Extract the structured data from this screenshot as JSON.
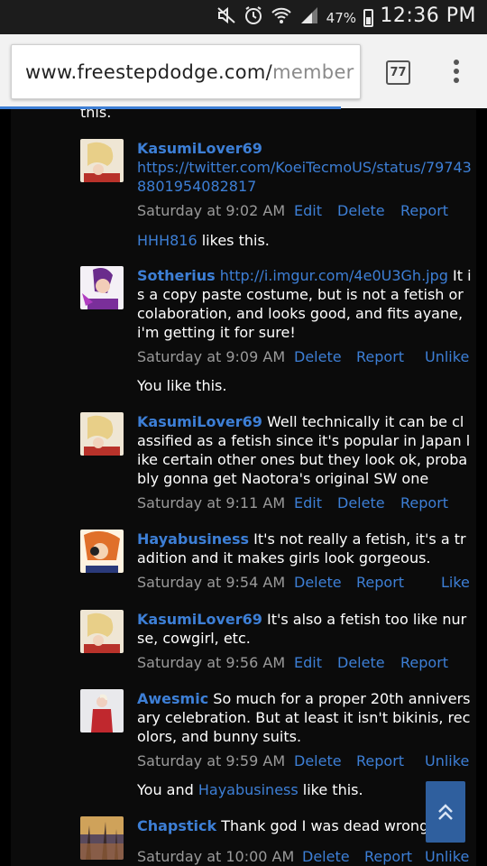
{
  "status_bar": {
    "battery": "47%",
    "time": "12:36 PM"
  },
  "url_bar": {
    "domain": "www.freestepdodge.com/",
    "path": "member",
    "tab_count": "77"
  },
  "thread": {
    "top_fragment": "this.",
    "comments": [
      {
        "user": "KasumiLover69",
        "link": "https://twitter.com/KoeiTecmoUS/status/797438801954082817",
        "text": "",
        "time": "Saturday at 9:02 AM",
        "actions": [
          "Edit",
          "Delete",
          "Report"
        ],
        "likes_user": "HHH816",
        "likes_text": " likes this."
      },
      {
        "user": "Sotherius",
        "link": "http://i.imgur.com/4e0U3Gh.jpg",
        "text": "It is a copy paste costume, but is not a fetish or colaboration, and looks good, and fits ayane, i'm getting it for sure!",
        "time": "Saturday at 9:09 AM",
        "actions": [
          "Delete",
          "Report",
          "Unlike"
        ],
        "likes_text": "You like this."
      },
      {
        "user": "KasumiLover69",
        "text": "Well technically it can be classified as a fetish since it's popular in Japan like certain other ones but they look ok, probably gonna get Naotora's original SW one",
        "time": "Saturday at 9:11 AM",
        "actions": [
          "Edit",
          "Delete",
          "Report"
        ]
      },
      {
        "user": "Hayabusiness",
        "text": "It's not really a fetish, it's a tradition and it makes girls look gorgeous.",
        "time": "Saturday at 9:54 AM",
        "actions": [
          "Delete",
          "Report",
          "Like"
        ]
      },
      {
        "user": "KasumiLover69",
        "text": "It's also a fetish too like nurse, cowgirl, etc.",
        "time": "Saturday at 9:56 AM",
        "actions": [
          "Edit",
          "Delete",
          "Report"
        ]
      },
      {
        "user": "Awesmic",
        "text": "So much for a proper 20th anniversary celebration. But at least it isn't bikinis, recolors, and bunny suits.",
        "time": "Saturday at 9:59 AM",
        "actions": [
          "Delete",
          "Report",
          "Unlike"
        ],
        "likes_prefix": "You and ",
        "likes_user": "Hayabusiness",
        "likes_text": " like this."
      },
      {
        "user": "Chapstick",
        "text": "Thank god I was dead wrong",
        "time": "Saturday at 10:00 AM",
        "actions": [
          "Delete",
          "Report",
          "Unlike"
        ]
      }
    ]
  },
  "colors": {
    "link": "#3d7fd6",
    "meta": "#9a9a9a",
    "background": "#0b0b0b"
  }
}
